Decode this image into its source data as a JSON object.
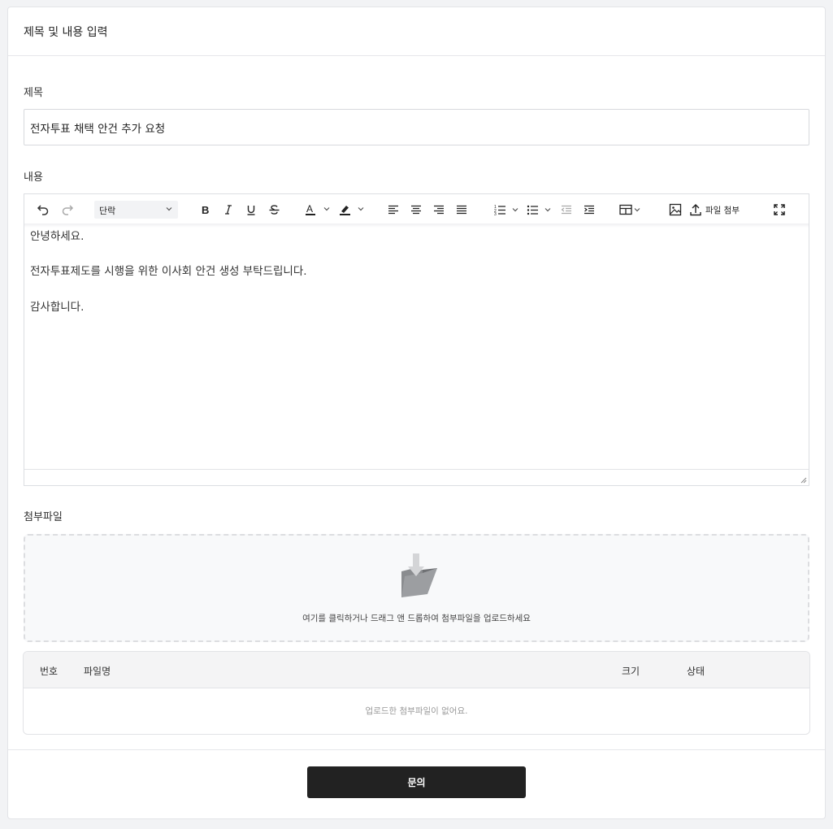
{
  "card": {
    "header_title": "제목 및 내용 입력"
  },
  "title_field": {
    "label": "제목",
    "value": "전자투표 채택 안건 추가 요청"
  },
  "content_field": {
    "label": "내용",
    "paragraph_style": "단락",
    "attach_label": "파일 첨부",
    "body": [
      "안녕하세요.",
      "",
      "전자투표제도를 시행을 위한 이사회 안건 생성 부탁드립니다.",
      "",
      "감사합니다."
    ]
  },
  "attachments": {
    "label": "첨부파일",
    "dropzone_text": "여기를 클릭하거나 드래그 앤 드롭하여 첨부파일을 업로드하세요",
    "columns": {
      "number": "번호",
      "filename": "파일명",
      "size": "크기",
      "status": "상태"
    },
    "empty_text": "업로드한 첨부파일이 없어요."
  },
  "footer": {
    "submit_label": "문의"
  },
  "colors": {
    "primary_button": "#222222",
    "page_background": "#f2f3f5"
  }
}
